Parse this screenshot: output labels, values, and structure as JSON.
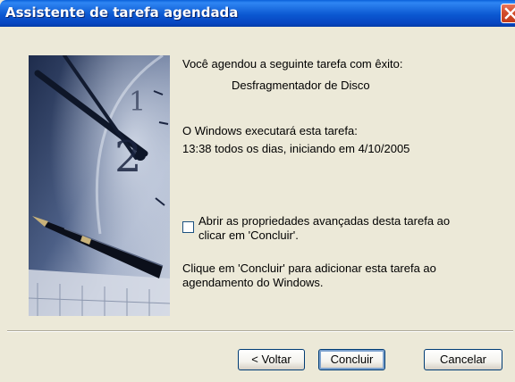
{
  "window": {
    "title": "Assistente de tarefa agendada"
  },
  "content": {
    "success_line": "Você agendou a seguinte tarefa com êxito:",
    "task_name": "Desfragmentador de Disco",
    "run_info_label": "O Windows executará esta tarefa:",
    "schedule": "13:38 todos os dias, iniciando em 4/10/2005",
    "checkbox_line1": "Abrir as propriedades avançadas desta tarefa ao",
    "checkbox_line2": "clicar em 'Concluir'.",
    "checkbox_checked": false,
    "finish_hint_line1": "Clique em 'Concluir' para adicionar esta tarefa ao",
    "finish_hint_line2": "agendamento do Windows."
  },
  "buttons": {
    "back": "< Voltar",
    "finish": "Concluir",
    "cancel": "Cancelar"
  },
  "icons": {
    "close": "close-icon",
    "side_image": "clock-and-fountain-pen-illustration"
  },
  "colors": {
    "titlebar": "#0B58D1",
    "close": "#D24D2B",
    "dialog_bg": "#ECE9D8"
  }
}
